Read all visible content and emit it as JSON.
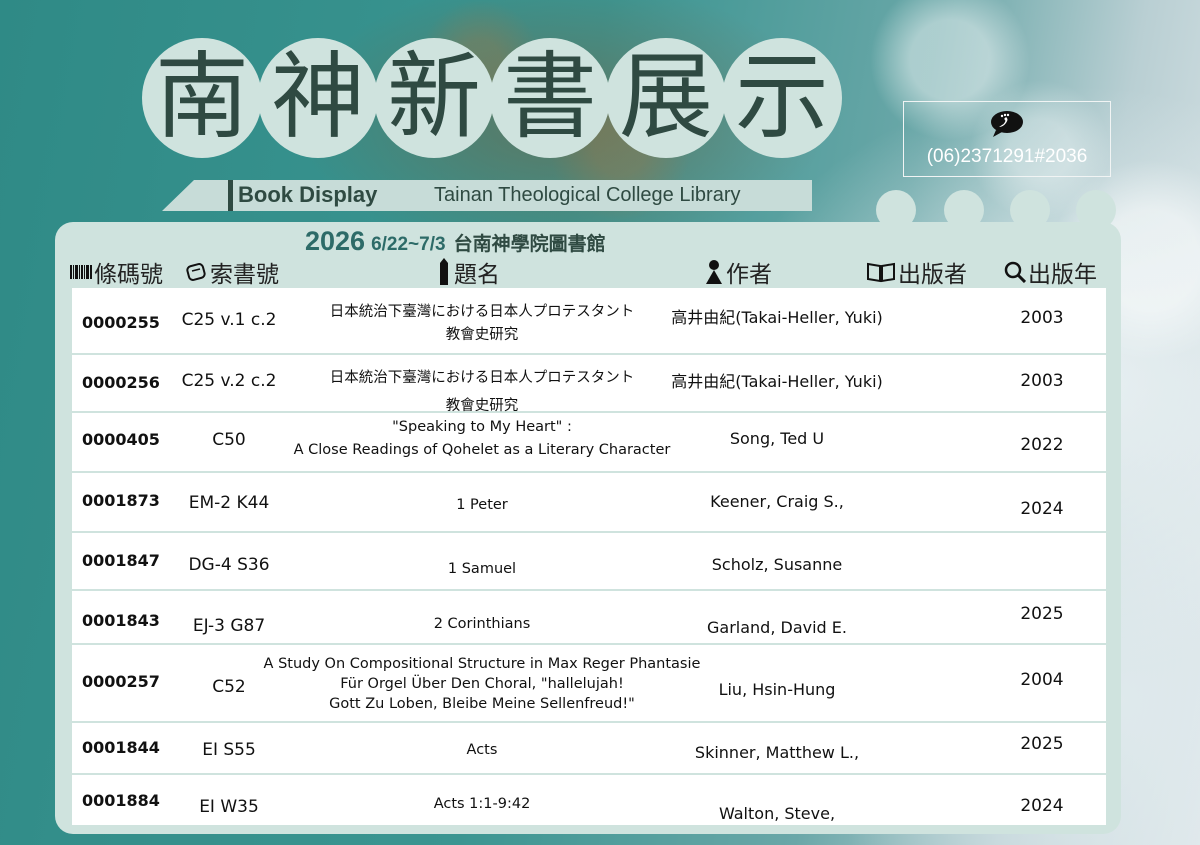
{
  "poster": {
    "title_chars": [
      "南",
      "神",
      "新",
      "書",
      "展",
      "示"
    ],
    "banner_left": "Book Display",
    "banner_right": "Tainan Theological College Library",
    "contact_phone": "(06)2371291#2036",
    "year": "2026",
    "date_range": "6/22~7/3",
    "org": "台南神學院圖書館"
  },
  "columns": {
    "barcode": "條碼號",
    "call_number": "索書號",
    "title": "題名",
    "author": "作者",
    "publisher": "出版者",
    "pub_year": "出版年"
  },
  "rows": [
    {
      "barcode": "0000255",
      "call": "C25 v.1 c.2",
      "title1": "日本統治下臺灣における日本人プロテスタント",
      "title2": "教會史研究",
      "title3": "",
      "author": "高井由紀(Takai-Heller, Yuki)",
      "year": "2003"
    },
    {
      "barcode": "0000256",
      "call": "C25 v.2 c.2",
      "title1": "日本統治下臺灣における日本人プロテスタント",
      "title2": "教會史研究",
      "title3": "",
      "author": "高井由紀(Takai-Heller, Yuki)",
      "year": "2003"
    },
    {
      "barcode": "0000405",
      "call": "C50",
      "title1": "\"Speaking to My Heart\" :",
      "title2": "A Close Readings of Qohelet as a Literary Character",
      "title3": "",
      "author": "Song, Ted U",
      "year": "2022"
    },
    {
      "barcode": "0001873",
      "call": "EM-2 K44",
      "title1": "1 Peter",
      "title2": "",
      "title3": "",
      "author": "Keener, Craig S.,",
      "year": "2024"
    },
    {
      "barcode": "0001847",
      "call": "DG-4 S36",
      "title1": "1 Samuel",
      "title2": "",
      "title3": "",
      "author": "Scholz, Susanne",
      "year": ""
    },
    {
      "barcode": "0001843",
      "call": "EJ-3 G87",
      "title1": "2 Corinthians",
      "title2": "",
      "title3": "",
      "author": "Garland, David E.",
      "year": "2025"
    },
    {
      "barcode": "0000257",
      "call": "C52",
      "title1": "A Study On Compositional Structure in Max Reger Phantasie",
      "title2": "Für Orgel Über Den Choral, \"hallelujah!",
      "title3": "Gott Zu Loben, Bleibe Meine Sellenfreud!\"",
      "author": "Liu, Hsin-Hung",
      "year": "2004"
    },
    {
      "barcode": "0001844",
      "call": "EI S55",
      "title1": "Acts",
      "title2": "",
      "title3": "",
      "author": "Skinner, Matthew L.,",
      "year": "2025"
    },
    {
      "barcode": "0001884",
      "call": "EI W35",
      "title1": "Acts 1:1-9:42",
      "title2": "",
      "title3": "",
      "author": "Walton, Steve,",
      "year": "2024"
    }
  ],
  "theme": {
    "accent": "#2f4a42",
    "panel": "#cfe3de",
    "teal": "#3b9591"
  }
}
